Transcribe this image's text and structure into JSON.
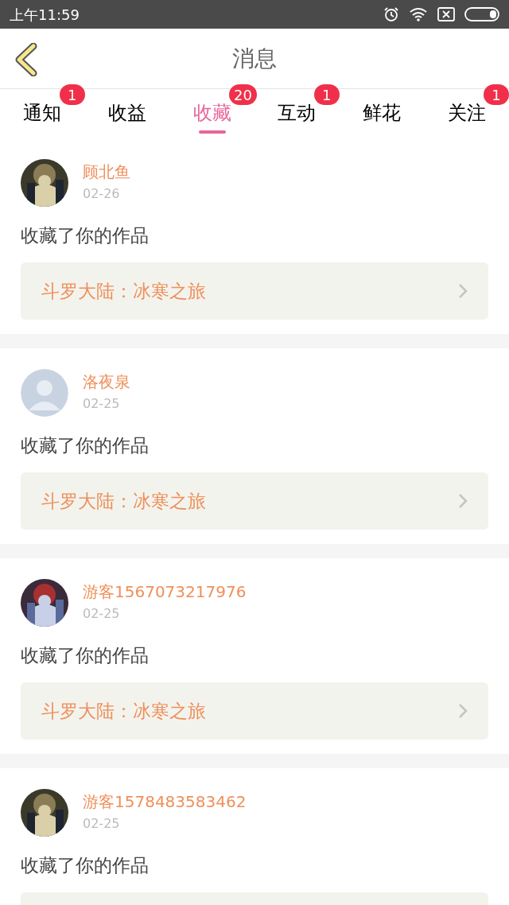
{
  "status_bar": {
    "time": "上午11:59"
  },
  "header": {
    "title": "消息"
  },
  "tabs": [
    {
      "label": "通知",
      "badge": "1",
      "selected": false
    },
    {
      "label": "收益",
      "selected": false
    },
    {
      "label": "收藏",
      "badge": "20",
      "selected": true
    },
    {
      "label": "互动",
      "badge": "1",
      "selected": false
    },
    {
      "label": "鲜花",
      "selected": false
    },
    {
      "label": "关注",
      "badge": "1",
      "selected": false
    }
  ],
  "messages": [
    {
      "name": "顾北鱼",
      "date": "02-26",
      "text": "收藏了你的作品",
      "work": "斗罗大陆：冰寒之旅"
    },
    {
      "avatar": {
        "kind": "default"
      },
      "name": "洛夜泉",
      "date": "02-25",
      "text": "收藏了你的作品",
      "work": "斗罗大陆：冰寒之旅"
    },
    {
      "name": "游客1567073217976",
      "date": "02-25",
      "text": "收藏了你的作品",
      "work": "斗罗大陆：冰寒之旅"
    },
    {
      "name": "游客1578483583462",
      "date": "02-25",
      "text": "收藏了你的作品"
    }
  ]
}
